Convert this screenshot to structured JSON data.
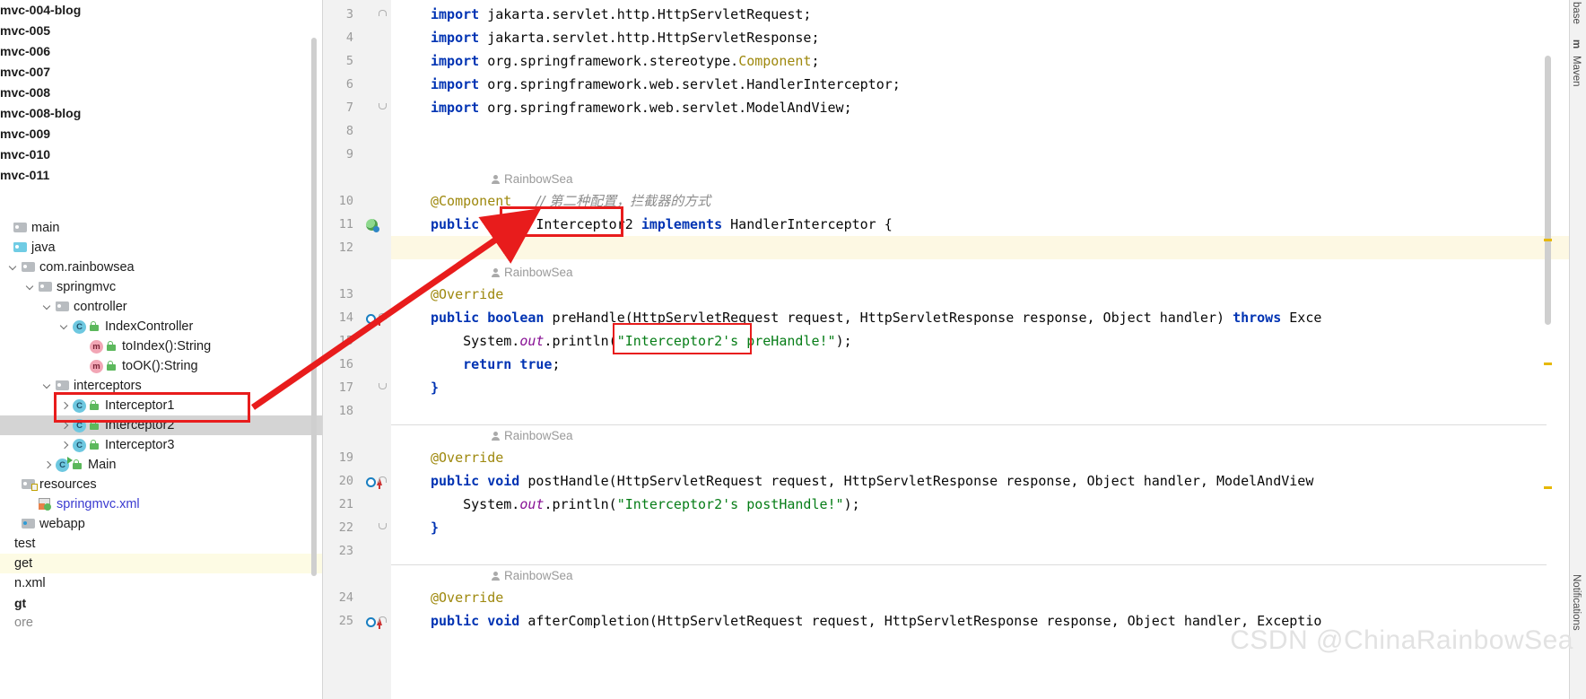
{
  "sidebar": {
    "top_modules": [
      {
        "label": "mvc-004-blog"
      },
      {
        "label": "mvc-005"
      },
      {
        "label": "mvc-006"
      },
      {
        "label": "mvc-007"
      },
      {
        "label": "mvc-008"
      },
      {
        "label": "mvc-008-blog"
      },
      {
        "label": "mvc-009"
      },
      {
        "label": "mvc-010"
      },
      {
        "label": "mvc-011"
      }
    ],
    "tree": [
      {
        "label": "main",
        "icon": "folder-icon",
        "depth": 0,
        "chevron": "none",
        "state": "normal"
      },
      {
        "label": "java",
        "icon": "source-folder-icon",
        "depth": 0,
        "chevron": "none",
        "state": "normal"
      },
      {
        "label": "com.rainbowsea",
        "icon": "package-icon",
        "depth": 1,
        "chevron": "down",
        "state": "normal"
      },
      {
        "label": "springmvc",
        "icon": "package-icon",
        "depth": 2,
        "chevron": "down",
        "state": "normal"
      },
      {
        "label": "controller",
        "icon": "package-icon",
        "depth": 3,
        "chevron": "down",
        "state": "normal"
      },
      {
        "label": "IndexController",
        "icon": "class-icon",
        "depth": 4,
        "chevron": "down",
        "state": "normal"
      },
      {
        "label": "toIndex():String",
        "icon": "method-icon",
        "depth": 5,
        "chevron": "none",
        "state": "normal"
      },
      {
        "label": "toOK():String",
        "icon": "method-icon",
        "depth": 5,
        "chevron": "none",
        "state": "normal"
      },
      {
        "label": "interceptors",
        "icon": "package-icon",
        "depth": 3,
        "chevron": "down",
        "state": "normal"
      },
      {
        "label": "Interceptor1",
        "icon": "class-icon",
        "depth": 4,
        "chevron": "right",
        "state": "normal"
      },
      {
        "label": "Interceptor2",
        "icon": "class-icon",
        "depth": 4,
        "chevron": "right",
        "state": "selected"
      },
      {
        "label": "Interceptor3",
        "icon": "class-icon",
        "depth": 4,
        "chevron": "right",
        "state": "normal"
      },
      {
        "label": "Main",
        "icon": "runnable-class-icon",
        "depth": 3,
        "chevron": "right",
        "state": "normal"
      },
      {
        "label": "resources",
        "icon": "resources-folder-icon",
        "depth": 1,
        "chevron": "none",
        "state": "normal"
      },
      {
        "label": "springmvc.xml",
        "icon": "xml-file-icon",
        "depth": 2,
        "chevron": "none",
        "state": "link"
      },
      {
        "label": "webapp",
        "icon": "webapp-folder-icon",
        "depth": 1,
        "chevron": "none",
        "state": "normal"
      },
      {
        "label": "test",
        "icon": "none",
        "depth": 0,
        "chevron": "none",
        "state": "normal"
      },
      {
        "label": "get",
        "icon": "none",
        "depth": 0,
        "chevron": "none",
        "state": "yellow"
      },
      {
        "label": "n.xml",
        "icon": "none",
        "depth": 0,
        "chevron": "none",
        "state": "normal"
      },
      {
        "label": "gt",
        "icon": "none",
        "depth": 0,
        "chevron": "none",
        "state": "bold"
      },
      {
        "label": "ore",
        "icon": "none",
        "depth": 0,
        "chevron": "none",
        "state": "fade"
      }
    ]
  },
  "editor": {
    "lines": [
      {
        "num": "3",
        "gmark": "",
        "fold": "close",
        "tokens": [
          {
            "t": "import ",
            "c": "kw"
          },
          {
            "t": "jakarta.servlet.http.HttpServletRequest;",
            "c": "cls"
          }
        ]
      },
      {
        "num": "4",
        "gmark": "",
        "fold": "",
        "tokens": [
          {
            "t": "import ",
            "c": "kw"
          },
          {
            "t": "jakarta.servlet.http.HttpServletResponse;",
            "c": "cls"
          }
        ]
      },
      {
        "num": "5",
        "gmark": "",
        "fold": "",
        "tokens": [
          {
            "t": "import ",
            "c": "kw"
          },
          {
            "t": "org.springframework.stereotype.",
            "c": "cls"
          },
          {
            "t": "Component",
            "c": "ann"
          },
          {
            "t": ";",
            "c": "cls"
          }
        ]
      },
      {
        "num": "6",
        "gmark": "",
        "fold": "",
        "tokens": [
          {
            "t": "import ",
            "c": "kw"
          },
          {
            "t": "org.springframework.web.servlet.HandlerInterceptor;",
            "c": "cls"
          }
        ]
      },
      {
        "num": "7",
        "gmark": "",
        "fold": "open",
        "tokens": [
          {
            "t": "import ",
            "c": "kw"
          },
          {
            "t": "org.springframework.web.servlet.ModelAndView;",
            "c": "cls"
          }
        ]
      },
      {
        "num": "8",
        "gmark": "",
        "fold": "",
        "tokens": []
      },
      {
        "num": "9",
        "gmark": "",
        "fold": "",
        "tokens": []
      },
      {
        "num": "10",
        "gmark": "",
        "fold": "",
        "tokens": [
          {
            "t": "@Component",
            "c": "ann"
          },
          {
            "t": "   ",
            "c": "cls"
          },
          {
            "t": "// 第二种配置，拦截器的方式",
            "c": "cmt"
          }
        ]
      },
      {
        "num": "11",
        "gmark": "bean",
        "fold": "",
        "tokens": [
          {
            "t": "public ",
            "c": "kw"
          },
          {
            "t": "class ",
            "c": "kw"
          },
          {
            "t": "Interceptor2 ",
            "c": "cls"
          },
          {
            "t": "implements ",
            "c": "kw"
          },
          {
            "t": "HandlerInterceptor {",
            "c": "cls"
          }
        ]
      },
      {
        "num": "12",
        "gmark": "",
        "fold": "",
        "tokens": []
      },
      {
        "num": "13",
        "gmark": "",
        "fold": "",
        "tokens": [
          {
            "t": "@Override",
            "c": "ann"
          }
        ]
      },
      {
        "num": "14",
        "gmark": "override",
        "fold": "close",
        "tokens": [
          {
            "t": "public ",
            "c": "kw"
          },
          {
            "t": "boolean ",
            "c": "kw"
          },
          {
            "t": "preHandle(HttpServletRequest request, HttpServletResponse response, Object handler) ",
            "c": "cls"
          },
          {
            "t": "throws ",
            "c": "kw"
          },
          {
            "t": "Exce",
            "c": "cls"
          }
        ]
      },
      {
        "num": "15",
        "gmark": "",
        "fold": "",
        "tokens": [
          {
            "t": "    System.",
            "c": "cls"
          },
          {
            "t": "out",
            "c": "fld"
          },
          {
            "t": ".println(",
            "c": "cls"
          },
          {
            "t": "\"Interceptor2's preHandle!\"",
            "c": "str"
          },
          {
            "t": ");",
            "c": "cls"
          }
        ]
      },
      {
        "num": "16",
        "gmark": "",
        "fold": "",
        "tokens": [
          {
            "t": "    return ",
            "c": "kw"
          },
          {
            "t": "true",
            "c": "kw"
          },
          {
            "t": ";",
            "c": "cls"
          }
        ]
      },
      {
        "num": "17",
        "gmark": "",
        "fold": "open",
        "tokens": [
          {
            "t": "}",
            "c": "kw"
          }
        ]
      },
      {
        "num": "18",
        "gmark": "",
        "fold": "",
        "tokens": []
      },
      {
        "num": "19",
        "gmark": "",
        "fold": "",
        "tokens": [
          {
            "t": "@Override",
            "c": "ann"
          }
        ]
      },
      {
        "num": "20",
        "gmark": "override",
        "fold": "close",
        "tokens": [
          {
            "t": "public ",
            "c": "kw"
          },
          {
            "t": "void ",
            "c": "kw"
          },
          {
            "t": "postHandle(HttpServletRequest request, HttpServletResponse response, Object handler, ModelAndView",
            "c": "cls"
          }
        ]
      },
      {
        "num": "21",
        "gmark": "",
        "fold": "",
        "tokens": [
          {
            "t": "    System.",
            "c": "cls"
          },
          {
            "t": "out",
            "c": "fld"
          },
          {
            "t": ".println(",
            "c": "cls"
          },
          {
            "t": "\"Interceptor2's postHandle!\"",
            "c": "str"
          },
          {
            "t": ");",
            "c": "cls"
          }
        ]
      },
      {
        "num": "22",
        "gmark": "",
        "fold": "open",
        "tokens": [
          {
            "t": "}",
            "c": "kw"
          }
        ]
      },
      {
        "num": "23",
        "gmark": "",
        "fold": "",
        "tokens": []
      },
      {
        "num": "24",
        "gmark": "",
        "fold": "",
        "tokens": [
          {
            "t": "@Override",
            "c": "ann"
          }
        ]
      },
      {
        "num": "25",
        "gmark": "override",
        "fold": "close",
        "tokens": [
          {
            "t": "public ",
            "c": "kw"
          },
          {
            "t": "void ",
            "c": "kw"
          },
          {
            "t": "afterCompletion(HttpServletRequest request, HttpServletResponse response, Object handler, Exceptio",
            "c": "cls"
          }
        ]
      }
    ],
    "author_tag": "RainbowSea"
  },
  "right_toolbar": {
    "items": [
      {
        "label": "base",
        "type": "tab"
      },
      {
        "label": "m",
        "type": "icon"
      },
      {
        "label": "Maven",
        "type": "tab"
      },
      {
        "label": "Notifications",
        "type": "tab"
      }
    ]
  },
  "watermark": "CSDN @ChinaRainbowSea",
  "colors": {
    "annotation_red": "#e81c1c",
    "selection_grey": "#d4d4d4",
    "caret_line": "#fdf8e3",
    "keyword_blue": "#0033b3",
    "string_green": "#067d17",
    "annotation_olive": "#9e880d"
  }
}
